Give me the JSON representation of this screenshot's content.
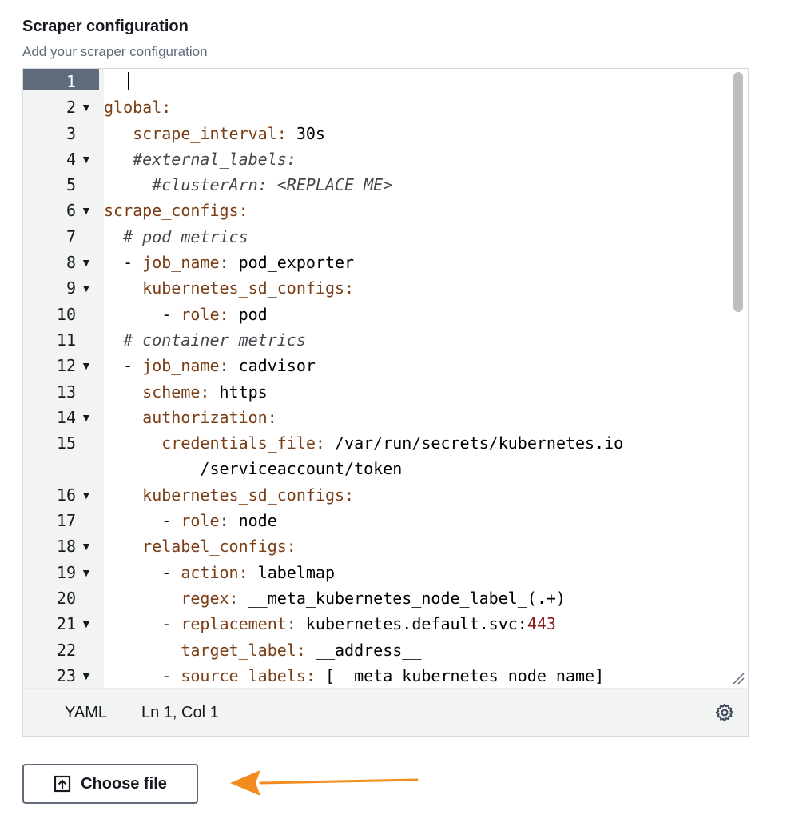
{
  "field": {
    "title": "Scraper configuration",
    "description": "Add your scraper configuration"
  },
  "editor": {
    "language": "YAML",
    "cursor_position": "Ln 1, Col 1",
    "lines": [
      {
        "num": "1",
        "fold": false,
        "active": true,
        "parts": []
      },
      {
        "num": "2",
        "fold": true,
        "parts": [
          {
            "t": "global:",
            "c": "k"
          }
        ]
      },
      {
        "num": "3",
        "fold": false,
        "parts": [
          {
            "t": "   "
          },
          {
            "t": "scrape_interval:",
            "c": "k"
          },
          {
            "t": " 30s"
          }
        ]
      },
      {
        "num": "4",
        "fold": true,
        "parts": [
          {
            "t": "   "
          },
          {
            "t": "#external_labels:",
            "c": "c"
          }
        ]
      },
      {
        "num": "5",
        "fold": false,
        "parts": [
          {
            "t": "     "
          },
          {
            "t": "#clusterArn: <REPLACE_ME>",
            "c": "c"
          }
        ]
      },
      {
        "num": "6",
        "fold": true,
        "parts": [
          {
            "t": "scrape_configs:",
            "c": "k"
          }
        ]
      },
      {
        "num": "7",
        "fold": false,
        "parts": [
          {
            "t": "  "
          },
          {
            "t": "# pod metrics",
            "c": "c"
          }
        ]
      },
      {
        "num": "8",
        "fold": true,
        "parts": [
          {
            "t": "  - "
          },
          {
            "t": "job_name:",
            "c": "k"
          },
          {
            "t": " pod_exporter"
          }
        ]
      },
      {
        "num": "9",
        "fold": true,
        "parts": [
          {
            "t": "    "
          },
          {
            "t": "kubernetes_sd_configs:",
            "c": "k"
          }
        ]
      },
      {
        "num": "10",
        "fold": false,
        "parts": [
          {
            "t": "      - "
          },
          {
            "t": "role:",
            "c": "k"
          },
          {
            "t": " pod"
          }
        ]
      },
      {
        "num": "11",
        "fold": false,
        "parts": [
          {
            "t": "  "
          },
          {
            "t": "# container metrics",
            "c": "c"
          }
        ]
      },
      {
        "num": "12",
        "fold": true,
        "parts": [
          {
            "t": "  - "
          },
          {
            "t": "job_name:",
            "c": "k"
          },
          {
            "t": " cadvisor"
          }
        ]
      },
      {
        "num": "13",
        "fold": false,
        "parts": [
          {
            "t": "    "
          },
          {
            "t": "scheme:",
            "c": "k"
          },
          {
            "t": " https"
          }
        ]
      },
      {
        "num": "14",
        "fold": true,
        "parts": [
          {
            "t": "    "
          },
          {
            "t": "authorization:",
            "c": "k"
          }
        ]
      },
      {
        "num": "15",
        "fold": false,
        "parts": [
          {
            "t": "      "
          },
          {
            "t": "credentials_file:",
            "c": "k"
          },
          {
            "t": " /var/run/secrets/kubernetes.io"
          }
        ]
      },
      {
        "num": "",
        "fold": false,
        "parts": [
          {
            "t": "          /serviceaccount/token"
          }
        ]
      },
      {
        "num": "16",
        "fold": true,
        "parts": [
          {
            "t": "    "
          },
          {
            "t": "kubernetes_sd_configs:",
            "c": "k"
          }
        ]
      },
      {
        "num": "17",
        "fold": false,
        "parts": [
          {
            "t": "      - "
          },
          {
            "t": "role:",
            "c": "k"
          },
          {
            "t": " node"
          }
        ]
      },
      {
        "num": "18",
        "fold": true,
        "parts": [
          {
            "t": "    "
          },
          {
            "t": "relabel_configs:",
            "c": "k"
          }
        ]
      },
      {
        "num": "19",
        "fold": true,
        "parts": [
          {
            "t": "      - "
          },
          {
            "t": "action:",
            "c": "k"
          },
          {
            "t": " labelmap"
          }
        ]
      },
      {
        "num": "20",
        "fold": false,
        "parts": [
          {
            "t": "        "
          },
          {
            "t": "regex:",
            "c": "k"
          },
          {
            "t": " __meta_kubernetes_node_label_(.+)"
          }
        ]
      },
      {
        "num": "21",
        "fold": true,
        "parts": [
          {
            "t": "      - "
          },
          {
            "t": "replacement:",
            "c": "k"
          },
          {
            "t": " kubernetes.default.svc:"
          },
          {
            "t": "443",
            "c": "n"
          }
        ]
      },
      {
        "num": "22",
        "fold": false,
        "parts": [
          {
            "t": "        "
          },
          {
            "t": "target_label:",
            "c": "k"
          },
          {
            "t": " __address__"
          }
        ]
      },
      {
        "num": "23",
        "fold": true,
        "parts": [
          {
            "t": "      - "
          },
          {
            "t": "source_labels:",
            "c": "k"
          },
          {
            "t": " [__meta_kubernetes_node_name]"
          }
        ]
      }
    ]
  },
  "upload": {
    "button_label": "Choose file"
  },
  "colors": {
    "annotation_arrow": "#f28c1e"
  }
}
